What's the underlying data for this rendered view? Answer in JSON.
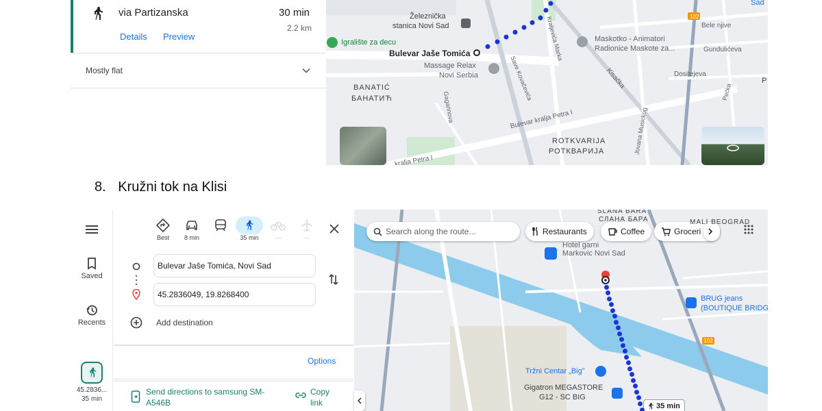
{
  "top_panel": {
    "route_via": "via Partizanska",
    "duration": "30 min",
    "distance": "2.2 km",
    "details_link": "Details",
    "preview_link": "Preview",
    "terrain": "Mostly flat"
  },
  "top_map": {
    "labels": {
      "station_1": "Železnička",
      "station_2": "stanica Novi Sad",
      "playground": "Igralište za decu",
      "origin": "Bulevar Jaše Tomića",
      "massage_1": "Massage Relax",
      "massage_2": "Novi Serbia",
      "banatic_lat": "BANATIĆ",
      "banatic_cyr": "БАНАТИЋ",
      "maskotko_1": "Maskotko - Animatori",
      "maskotko_2": "Radionice Maskote za...",
      "bele_njive": "Bele njive",
      "gundulic": "Gundulićeva",
      "dositejeva": "Dositejeva",
      "kisacka": "Kisačka",
      "kraljevica_marka": "Kraljevića Marka",
      "save_kovacevica": "Save Kovačevića",
      "gagarinova": "Gagarinova",
      "bulevar_petra": "Bulevar kralja Petra I",
      "kralja_petra": "kralja Petra I",
      "rotkvarija_lat": "ROTKVARIJA",
      "rotkvarija_cyr": "РОТКВАРИЈА",
      "jovana_music": "Jovana Musickog",
      "pecka": "Pećka",
      "road_102": "102",
      "sad_edge": "Sad",
      "edge_p": "P"
    }
  },
  "heading": {
    "number": "8.",
    "text": "Kružni tok na Klisi"
  },
  "bottom": {
    "rail": {
      "saved": "Saved",
      "recents": "Recents",
      "current_1": "45.2836...",
      "current_2": "35 min"
    },
    "modes": [
      {
        "label": "Best",
        "icon": "diamond-directions-icon"
      },
      {
        "label": "8 min",
        "icon": "car-icon"
      },
      {
        "label": "",
        "icon": "transit-icon"
      },
      {
        "label": "35 min",
        "icon": "walk-icon"
      },
      {
        "label": "—",
        "icon": "bike-icon"
      },
      {
        "label": "—",
        "icon": "plane-icon"
      }
    ],
    "origin_value": "Bulevar Jaše Tomića, Novi Sad",
    "destination_value": "45.2836049, 19.8268400",
    "add_destination": "Add destination",
    "options": "Options",
    "send_directions": "Send directions to samsung SM-A546B",
    "copy_link": "Copy link",
    "map": {
      "search_placeholder": "Search along the route...",
      "chip_restaurants": "Restaurants",
      "chip_coffee": "Coffee",
      "chip_groceries": "Groceri",
      "slana_bara_lat": "SLANA BARA",
      "slana_bara_cyr": "СЛАНА БАРА",
      "mali_beograd": "MALI BEOGRAD",
      "hotel_1": "Hotel garni",
      "hotel_2": "Markovic Novi Sad",
      "brug_1": "BRUG jeans",
      "brug_2": "(BOUTIQUE BRIDG",
      "trzni": "Tržni Centar „Big\"",
      "gigatron_1": "Gigatron MEGASTORE",
      "gigatron_2": "G12 - SC BIG",
      "route_time": "35 min",
      "road_102": "102"
    }
  },
  "colors": {
    "route_blue": "#1a37d6",
    "accent_teal": "#1a7f6e",
    "link_blue": "#1a73e8",
    "water": "#7fc7e8",
    "pin_red": "#ea4335"
  }
}
